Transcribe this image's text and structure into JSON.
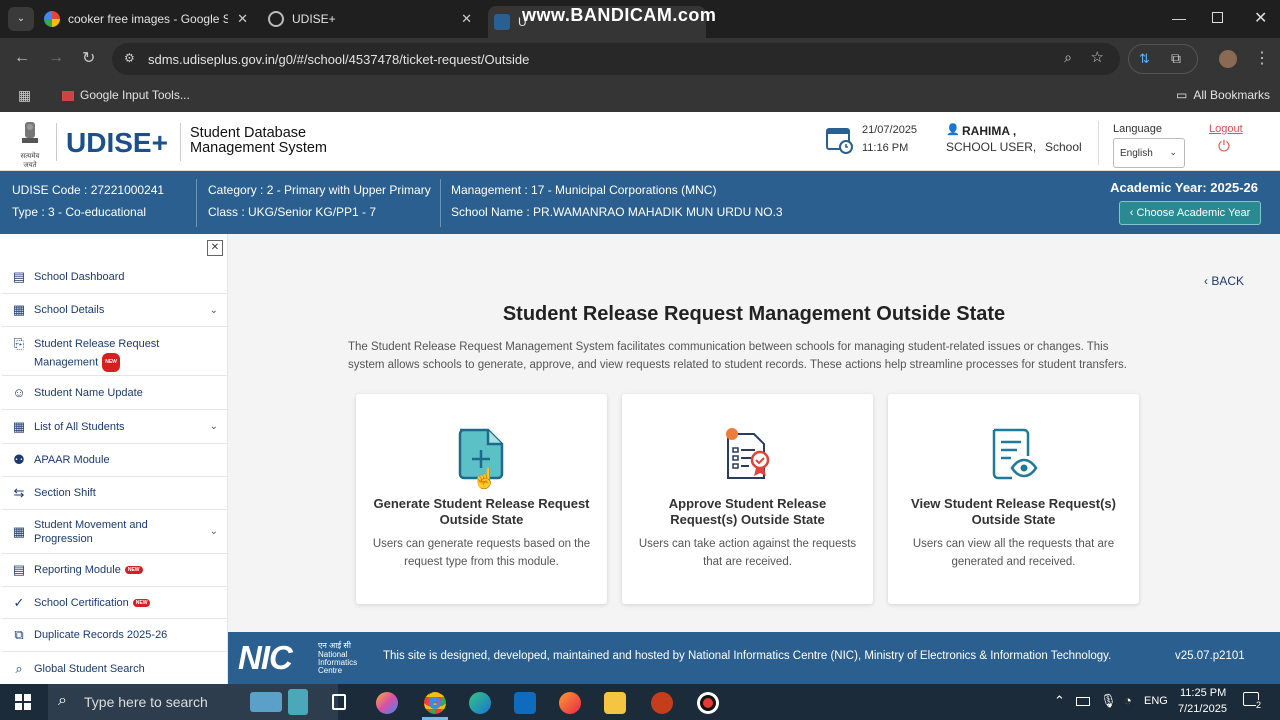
{
  "browser": {
    "tabs": [
      {
        "title": "cooker free images - Google Se",
        "close": "✕"
      },
      {
        "title": "UDISE+",
        "close": "✕"
      },
      {
        "title": "U",
        "close": "✕"
      }
    ],
    "watermark": "www.BANDICAM.com",
    "url": "sdms.udiseplus.gov.in/g0/#/school/4537478/ticket-request/Outside",
    "bookmarks": {
      "first": "Google Input Tools...",
      "all": "All Bookmarks"
    }
  },
  "header": {
    "emblem_caption": "सत्यमेव जयते",
    "brand": "UDISE+",
    "system_title_line1": "Student Database",
    "system_title_line2": "Management System",
    "date": "21/07/2025",
    "time": "11:16 PM",
    "user_name": "RAHIMA ,",
    "user_role": "SCHOOL USER,",
    "user_type": "School",
    "language_label": "Language",
    "language_value": "English",
    "logout": "Logout"
  },
  "school": {
    "udise_code": "UDISE Code : 27221000241",
    "type": "Type : 3 - Co-educational",
    "category": "Category : 2 - Primary with Upper Primary",
    "class": "Class : UKG/Senior KG/PP1 - 7",
    "management": "Management : 17 - Municipal Corporations (MNC)",
    "school_name": "School Name : PR.WAMANRAO MAHADIK MUN URDU NO.3",
    "academic_year": "Academic Year: 2025-26",
    "choose_year": "Choose Academic Year"
  },
  "sidebar": {
    "close": "✕",
    "items": [
      {
        "label": "School Dashboard"
      },
      {
        "label": "School Details"
      },
      {
        "label": "Student Release Request",
        "label2": "Management",
        "badge": "NEW"
      },
      {
        "label": "Student Name Update"
      },
      {
        "label": "List of All Students"
      },
      {
        "label": "APAAR Module"
      },
      {
        "label": "Section Shift"
      },
      {
        "label": "Student Movement and",
        "label2": "Progression"
      },
      {
        "label": "Reporting Module",
        "badge": "NEW"
      },
      {
        "label": "School Certification",
        "badge": "NEW"
      },
      {
        "label": "Duplicate Records 2025-26"
      },
      {
        "label": "Global Student Search"
      }
    ]
  },
  "main": {
    "back": "BACK",
    "title": "Student Release Request Management Outside State",
    "description_line1": "The Student Release Request Management System facilitates communication between schools for managing student-related issues or changes. This",
    "description_line2": "system allows schools to generate, approve, and view requests related to student records. These actions help streamline processes for student transfers.",
    "cards": [
      {
        "title1": "Generate Student Release Request",
        "title2": "Outside State",
        "desc1": "Users can generate requests based on the",
        "desc2": "request type from this module."
      },
      {
        "title1": "Approve Student Release",
        "title2": "Request(s) Outside State",
        "desc1": "Users can take action against the requests",
        "desc2": "that are received."
      },
      {
        "title1": "View Student Release Request(s)",
        "title2": "Outside State",
        "desc1": "Users can view all the requests that are",
        "desc2": "generated and received."
      }
    ]
  },
  "footer": {
    "nic_logo": "NIC",
    "nic_hindi": "एन आई सी",
    "nic_line1": "National",
    "nic_line2": "Informatics",
    "nic_line3": "Centre",
    "text": "This site is designed, developed, maintained and hosted by National Informatics Centre (NIC), Ministry of Electronics & Information Technology.",
    "version": "v25.07.p2101"
  },
  "taskbar": {
    "search_placeholder": "Type here to search",
    "lang": "ENG",
    "time": "11:25 PM",
    "date": "7/21/2025",
    "notif_count": "2"
  },
  "colors": {
    "primary": "#2a5f8f",
    "teal": "#2a8a92",
    "chrome_dark": "#1f1f1f"
  }
}
